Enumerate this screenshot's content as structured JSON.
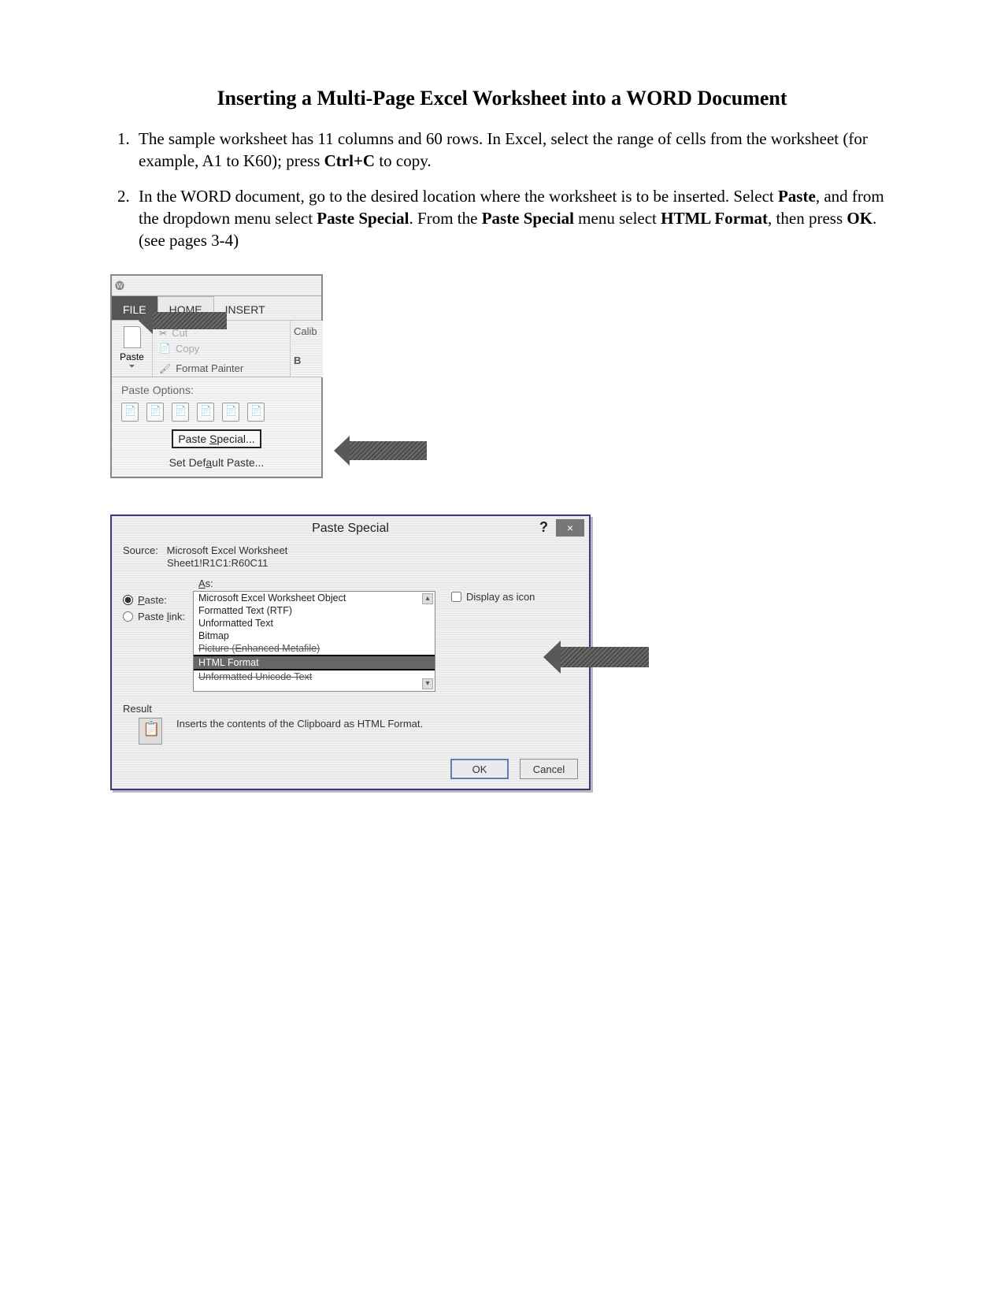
{
  "title": "Inserting a Multi-Page Excel Worksheet into a WORD Document",
  "steps": {
    "item1_a": "The sample worksheet has 11 columns and 60 rows. In Excel, select the range of cells from the worksheet (for example, A1 to K60); press ",
    "item1_b": "Ctrl+C",
    "item1_c": " to copy.",
    "item2_a": "In the WORD document, go to the desired location where the worksheet is to be inserted. Select ",
    "item2_b": "Paste",
    "item2_c": ", and from the dropdown menu select ",
    "item2_d": "Paste Special",
    "item2_e": ". From the ",
    "item2_f": "Paste Special",
    "item2_g": " menu select ",
    "item2_h": "HTML Format",
    "item2_i": ", then press ",
    "item2_j": "OK",
    "item2_k": ". (see pages 3-4)"
  },
  "ribbon": {
    "tabs": {
      "file": "FILE",
      "home": "HOME",
      "insert": "INSERT"
    },
    "paste": "Paste",
    "cut": "Cut",
    "copy": "Copy",
    "format_painter": "Format Painter",
    "font_name": "Calib",
    "bold": "B",
    "options_title": "Paste Options:",
    "paste_special": "Paste Special...",
    "paste_special_mn": "S",
    "set_default": "Set Default Paste...",
    "set_default_mn": "a"
  },
  "dialog": {
    "title": "Paste Special",
    "source_label": "Source:",
    "source_val": "Microsoft Excel Worksheet",
    "source_range": "Sheet1!R1C1:R60C11",
    "as_label": "As:",
    "radio_paste": "Paste:",
    "radio_pastelink": "Paste link:",
    "options": {
      "o1": "Microsoft Excel Worksheet Object",
      "o2": "Formatted Text (RTF)",
      "o3": "Unformatted Text",
      "o4": "Bitmap",
      "o5": "Picture (Enhanced Metafile)",
      "o6": "HTML Format",
      "o7": "Unformatted Unicode Text"
    },
    "display_as_icon": "Display as icon",
    "result_label": "Result",
    "result_text": "Inserts the contents of the Clipboard as HTML Format.",
    "ok": "OK",
    "cancel": "Cancel"
  }
}
